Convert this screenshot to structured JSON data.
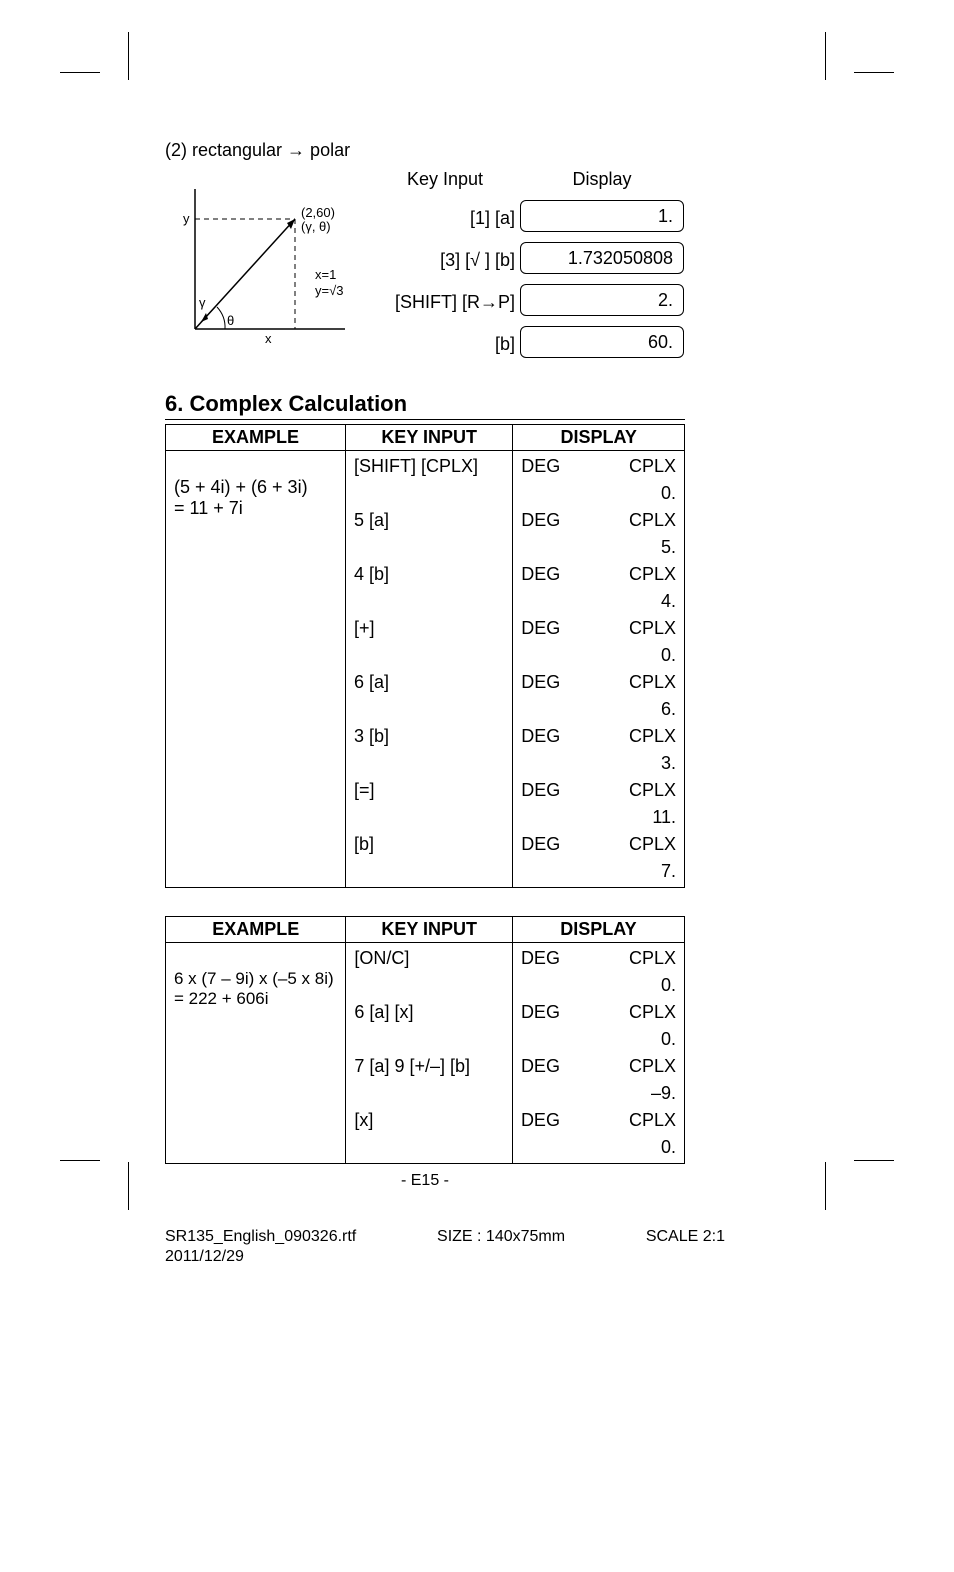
{
  "intro": "(2) rectangular → polar",
  "diagram": {
    "y_label": "y",
    "x_label": "x",
    "point_top": "(2,60)",
    "point_bot": "(γ, θ)",
    "xy_eq1": "x=1",
    "xy_eq2": "y=√3",
    "gamma": "γ",
    "theta": "θ"
  },
  "kv_header": "Key Input",
  "disp_header": "Display",
  "rows2": [
    {
      "key": "[1] [a]",
      "disp": "1."
    },
    {
      "key": "[3] [√ ] [b]",
      "disp": "1.732050808"
    },
    {
      "key": "[SHIFT] [R→P]",
      "disp": "2."
    },
    {
      "key": "[b]",
      "disp": "60."
    }
  ],
  "section_title": "6. Complex Calculation",
  "table1": {
    "headers": [
      "EXAMPLE",
      "KEY   INPUT",
      "DISPLAY"
    ],
    "example": [
      "(5 + 4i) + (6 + 3i)",
      "= 11 + 7i"
    ],
    "steps": [
      {
        "key": "[SHIFT] [CPLX]",
        "mode": "DEG",
        "flag": "CPLX",
        "val": "0."
      },
      {
        "key": "5 [a]",
        "mode": "DEG",
        "flag": "CPLX",
        "val": "5."
      },
      {
        "key": "4 [b]",
        "mode": "DEG",
        "flag": "CPLX",
        "val": "4."
      },
      {
        "key": "[+]",
        "mode": "DEG",
        "flag": "CPLX",
        "val": "0."
      },
      {
        "key": "6 [a]",
        "mode": "DEG",
        "flag": "CPLX",
        "val": "6."
      },
      {
        "key": "3 [b]",
        "mode": "DEG",
        "flag": "CPLX",
        "val": "3."
      },
      {
        "key": "[=]",
        "mode": "DEG",
        "flag": "CPLX",
        "val": "11."
      },
      {
        "key": "[b]",
        "mode": "DEG",
        "flag": "CPLX",
        "val": "7."
      }
    ]
  },
  "table2": {
    "headers": [
      "EXAMPLE",
      "KEY   INPUT",
      "DISPLAY"
    ],
    "example": [
      "6 x (7 – 9i) x (–5 x 8i)",
      "= 222 + 606i"
    ],
    "steps": [
      {
        "key": "[ON/C]",
        "mode": "DEG",
        "flag": "CPLX",
        "val": "0."
      },
      {
        "key": "6 [a] [x]",
        "mode": "DEG",
        "flag": "CPLX",
        "val": "0."
      },
      {
        "key": "7 [a] 9 [+/–] [b]",
        "mode": "DEG",
        "flag": "CPLX",
        "val": "–9."
      },
      {
        "key": "[x]",
        "mode": "DEG",
        "flag": "CPLX",
        "val": "0."
      }
    ]
  },
  "page_num": "- E15 -",
  "footer": {
    "file": "SR135_English_090326.rtf",
    "size": "SIZE   :   140x75mm",
    "scale": "SCALE   2:1",
    "date": "2011/12/29"
  }
}
